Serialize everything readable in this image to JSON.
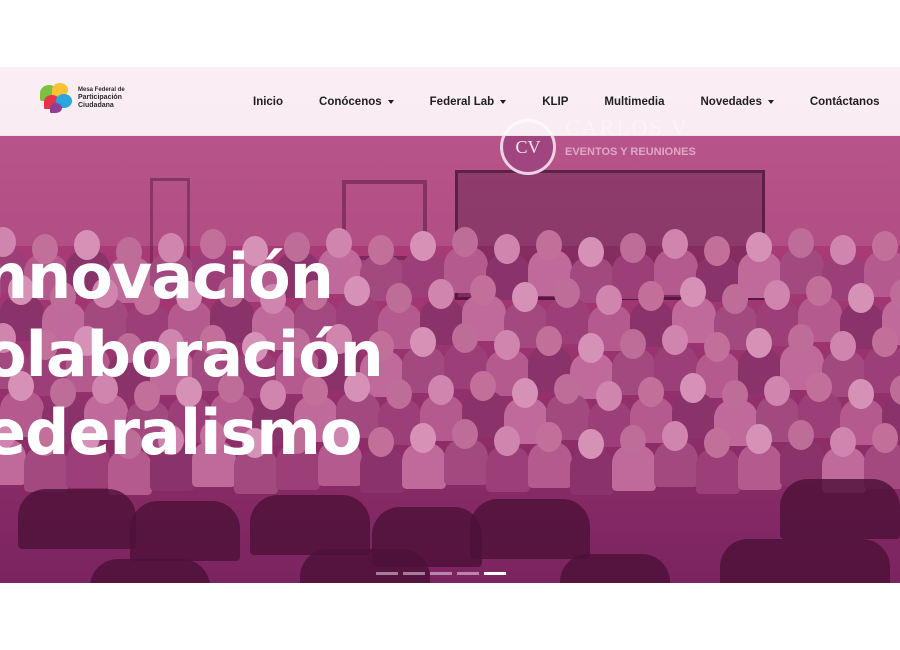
{
  "brand": {
    "line1": "Mesa Federal de",
    "line2": "Participación",
    "line3": "Ciudadana",
    "logo_colors": [
      "#7cc242",
      "#f7c234",
      "#e5334a",
      "#2aa6de",
      "#8e3f95"
    ]
  },
  "nav": {
    "items": [
      {
        "label": "Inicio",
        "has_dropdown": false
      },
      {
        "label": "Conócenos",
        "has_dropdown": true
      },
      {
        "label": "Federal Lab",
        "has_dropdown": true
      },
      {
        "label": "KLIP",
        "has_dropdown": false
      },
      {
        "label": "Multimedia",
        "has_dropdown": false
      },
      {
        "label": "Novedades",
        "has_dropdown": true
      },
      {
        "label": "Contáctanos",
        "has_dropdown": false
      }
    ]
  },
  "hero": {
    "lines": [
      "nnovación",
      "olaboración",
      "ederalismo"
    ],
    "overlay_color": "#a93a77",
    "background_sign": {
      "logo_text": "CV",
      "title": "CARLOS V",
      "subtitle": "EVENTOS Y REUNIONES"
    },
    "carousel": {
      "slide_count": 5,
      "active_index": 4
    }
  }
}
